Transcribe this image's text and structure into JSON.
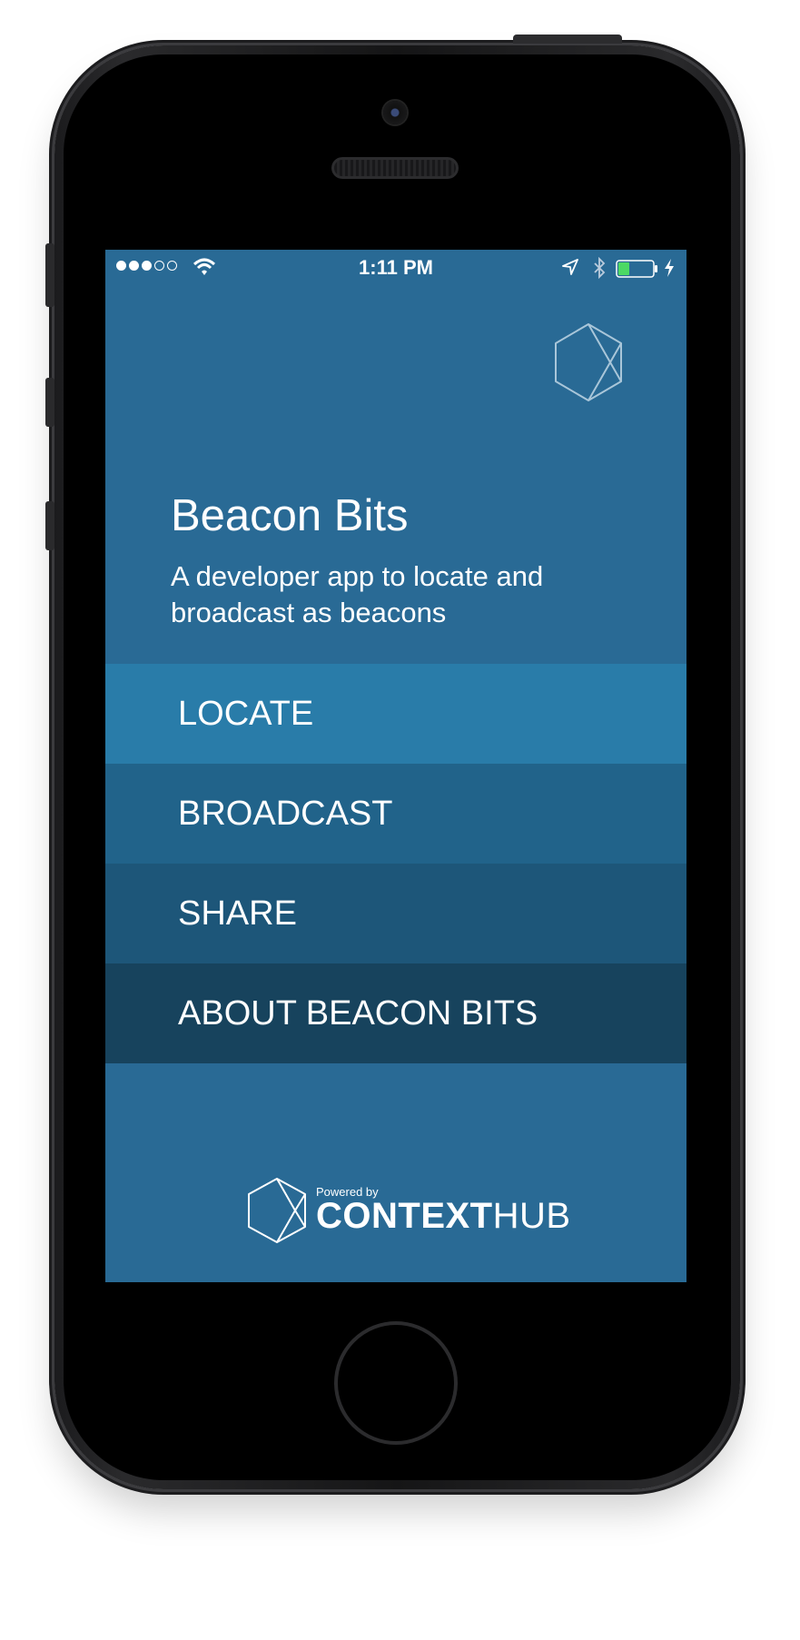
{
  "status_bar": {
    "time": "1:11 PM",
    "signal_bars_filled": 3,
    "signal_bars_total": 5,
    "battery_level": 0.3
  },
  "app": {
    "title": "Beacon Bits",
    "subtitle": "A developer app to locate and broadcast as beacons"
  },
  "menu": {
    "items": [
      {
        "label": "LOCATE",
        "color": "#297ca9"
      },
      {
        "label": "BROADCAST",
        "color": "#21638a"
      },
      {
        "label": "SHARE",
        "color": "#1d5679"
      },
      {
        "label": "ABOUT BEACON BITS",
        "color": "#17435d"
      }
    ]
  },
  "footer": {
    "powered_by": "Powered by",
    "brand_bold": "CONTEXT",
    "brand_light": "HUB"
  },
  "colors": {
    "screen_background": "#296a95"
  },
  "icons": [
    "wifi-icon",
    "location-arrow-icon",
    "bluetooth-icon",
    "battery-icon",
    "charging-icon",
    "hexagon-logo-icon"
  ]
}
